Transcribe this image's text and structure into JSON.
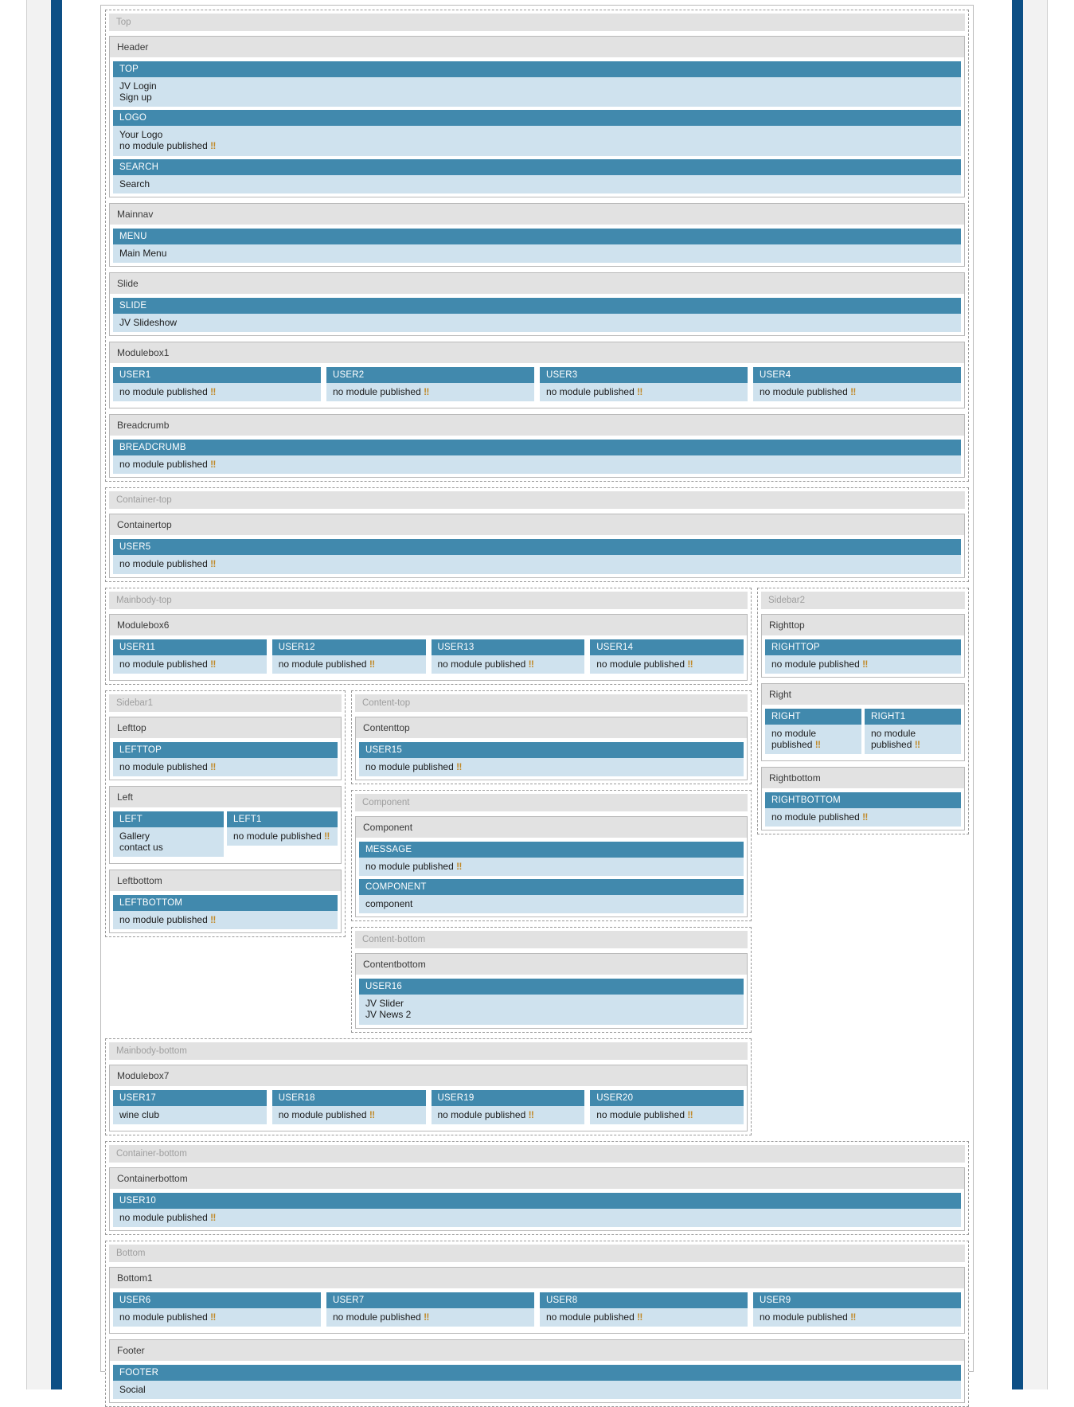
{
  "labels": {
    "no_module": "no module published",
    "no_module_mark": "‼"
  },
  "sections": {
    "top": {
      "group_title": "Top",
      "header": {
        "title": "Header",
        "modules": [
          {
            "head": "TOP",
            "lines": [
              "JV Login",
              "Sign up"
            ]
          },
          {
            "head": "LOGO",
            "lines": [
              "Your Logo",
              "no module published ‼"
            ]
          },
          {
            "head": "SEARCH",
            "lines": [
              "Search"
            ]
          }
        ]
      },
      "mainnav": {
        "title": "Mainnav",
        "modules": [
          {
            "head": "MENU",
            "lines": [
              "Main Menu"
            ]
          }
        ]
      },
      "slide": {
        "title": "Slide",
        "modules": [
          {
            "head": "SLIDE",
            "lines": [
              "JV Slideshow"
            ]
          }
        ]
      },
      "modulebox1": {
        "title": "Modulebox1",
        "modules": [
          {
            "head": "USER1",
            "lines": [
              "no module published ‼"
            ]
          },
          {
            "head": "USER2",
            "lines": [
              "no module published ‼"
            ]
          },
          {
            "head": "USER3",
            "lines": [
              "no module published ‼"
            ]
          },
          {
            "head": "USER4",
            "lines": [
              "no module published ‼"
            ]
          }
        ]
      },
      "breadcrumb": {
        "title": "Breadcrumb",
        "modules": [
          {
            "head": "BREADCRUMB",
            "lines": [
              "no module published ‼"
            ]
          }
        ]
      }
    },
    "container_top": {
      "group_title": "Container-top",
      "containertop": {
        "title": "Containertop",
        "modules": [
          {
            "head": "USER5",
            "lines": [
              "no module published ‼"
            ]
          }
        ]
      }
    },
    "mainbody_top": {
      "group_title": "Mainbody-top",
      "modulebox6": {
        "title": "Modulebox6",
        "modules": [
          {
            "head": "USER11",
            "lines": [
              "no module published ‼"
            ]
          },
          {
            "head": "USER12",
            "lines": [
              "no module published ‼"
            ]
          },
          {
            "head": "USER13",
            "lines": [
              "no module published ‼"
            ]
          },
          {
            "head": "USER14",
            "lines": [
              "no module published ‼"
            ]
          }
        ]
      }
    },
    "sidebar2": {
      "group_title": "Sidebar2",
      "righttop": {
        "title": "Righttop",
        "modules": [
          {
            "head": "RIGHTTOP",
            "lines": [
              "no module published ‼"
            ]
          }
        ]
      },
      "right": {
        "title": "Right",
        "modules": [
          {
            "head": "RIGHT",
            "lines": [
              "no module published ‼"
            ]
          },
          {
            "head": "RIGHT1",
            "lines": [
              "no module published ‼"
            ]
          }
        ]
      },
      "rightbottom": {
        "title": "Rightbottom",
        "modules": [
          {
            "head": "RIGHTBOTTOM",
            "lines": [
              "no module published ‼"
            ]
          }
        ]
      }
    },
    "sidebar1": {
      "group_title": "Sidebar1",
      "lefttop": {
        "title": "Lefttop",
        "modules": [
          {
            "head": "LEFTTOP",
            "lines": [
              "no module published ‼"
            ]
          }
        ]
      },
      "left": {
        "title": "Left",
        "modules": [
          {
            "head": "LEFT",
            "lines": [
              "Gallery",
              "contact us"
            ]
          },
          {
            "head": "LEFT1",
            "lines": [
              "no module published ‼"
            ]
          }
        ]
      },
      "leftbottom": {
        "title": "Leftbottom",
        "modules": [
          {
            "head": "LEFTBOTTOM",
            "lines": [
              "no module published ‼"
            ]
          }
        ]
      }
    },
    "content_top": {
      "group_title": "Content-top",
      "contenttop": {
        "title": "Contenttop",
        "modules": [
          {
            "head": "USER15",
            "lines": [
              "no module published ‼"
            ]
          }
        ]
      }
    },
    "component": {
      "group_title": "Component",
      "component": {
        "title": "Component",
        "modules": [
          {
            "head": "MESSAGE",
            "lines": [
              "no module published ‼"
            ]
          },
          {
            "head": "COMPONENT",
            "lines": [
              "component"
            ]
          }
        ]
      }
    },
    "content_bottom": {
      "group_title": "Content-bottom",
      "contentbottom": {
        "title": "Contentbottom",
        "modules": [
          {
            "head": "USER16",
            "lines": [
              "JV Slider",
              "JV News 2"
            ]
          }
        ]
      }
    },
    "mainbody_bottom": {
      "group_title": "Mainbody-bottom",
      "modulebox7": {
        "title": "Modulebox7",
        "modules": [
          {
            "head": "USER17",
            "lines": [
              "wine club"
            ]
          },
          {
            "head": "USER18",
            "lines": [
              "no module published ‼"
            ]
          },
          {
            "head": "USER19",
            "lines": [
              "no module published ‼"
            ]
          },
          {
            "head": "USER20",
            "lines": [
              "no module published ‼"
            ]
          }
        ]
      }
    },
    "container_bottom": {
      "group_title": "Container-bottom",
      "containerbottom": {
        "title": "Containerbottom",
        "modules": [
          {
            "head": "USER10",
            "lines": [
              "no module published ‼"
            ]
          }
        ]
      }
    },
    "bottom": {
      "group_title": "Bottom",
      "bottom1": {
        "title": "Bottom1",
        "modules": [
          {
            "head": "USER6",
            "lines": [
              "no module published ‼"
            ]
          },
          {
            "head": "USER7",
            "lines": [
              "no module published ‼"
            ]
          },
          {
            "head": "USER8",
            "lines": [
              "no module published ‼"
            ]
          },
          {
            "head": "USER9",
            "lines": [
              "no module published ‼"
            ]
          }
        ]
      },
      "footer": {
        "title": "Footer",
        "modules": [
          {
            "head": "FOOTER",
            "lines": [
              "Social"
            ]
          }
        ]
      }
    }
  },
  "colors": {
    "module_header": "#4189ad",
    "module_body": "#cfe2ee",
    "group_title_bg": "#e2e2e2",
    "rail_blue": "#0d4f85"
  }
}
